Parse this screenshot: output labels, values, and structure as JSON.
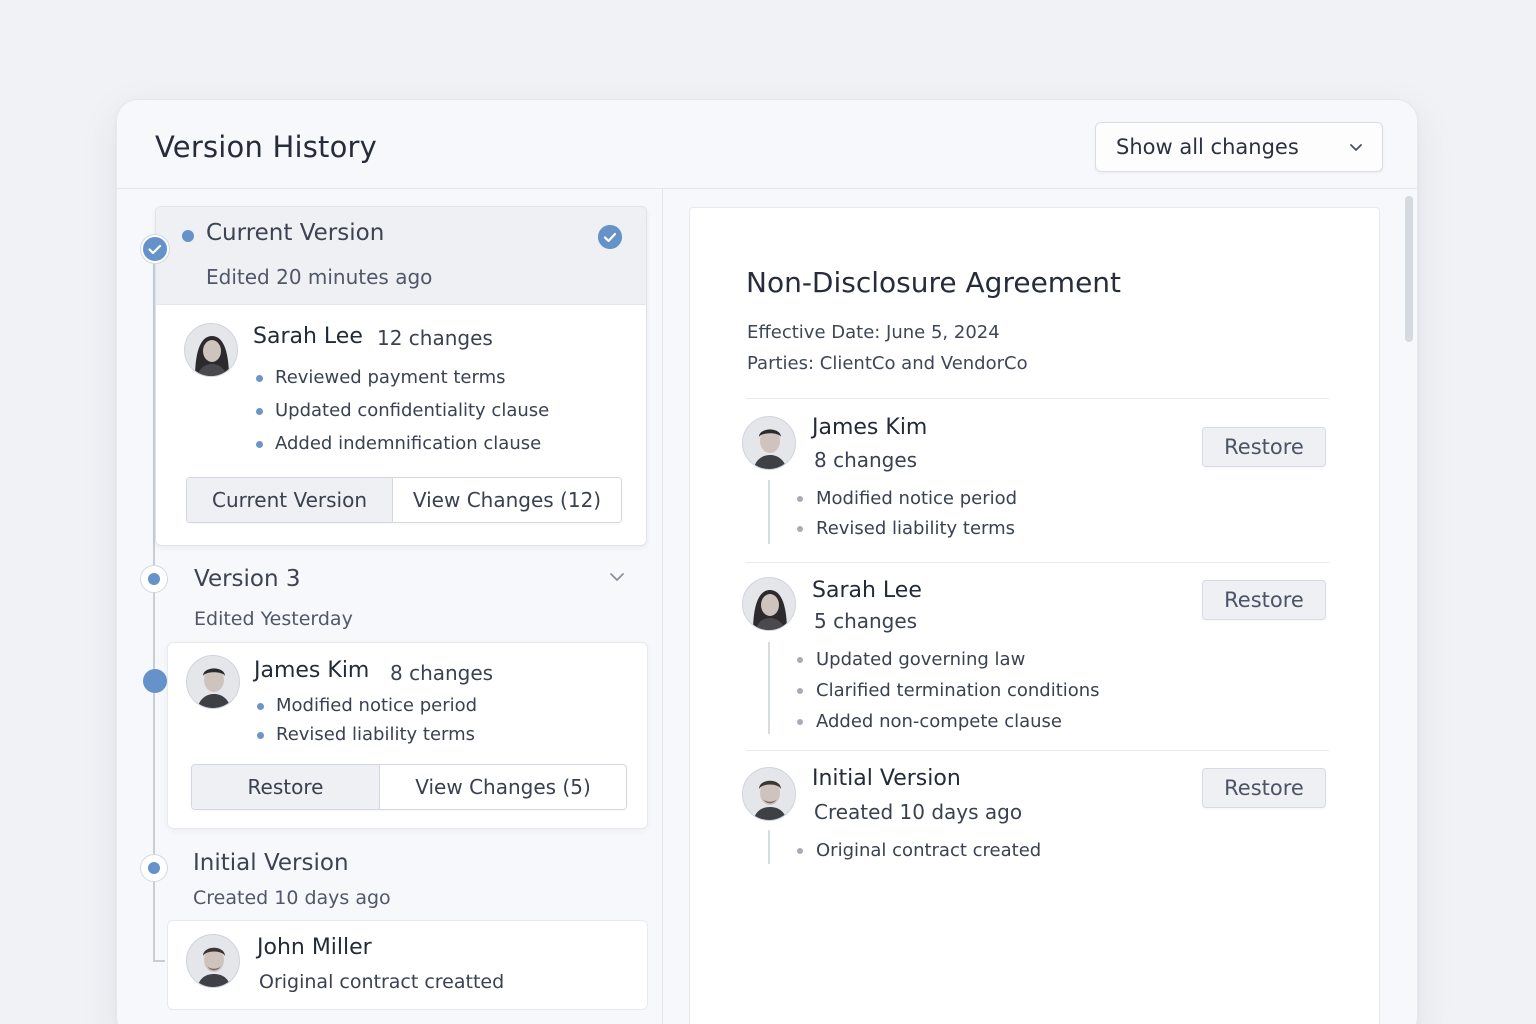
{
  "header": {
    "title": "Version History",
    "filter": "Show all changes"
  },
  "timeline": {
    "current": {
      "title": "Current Version",
      "subtitle": "Edited 20 minutes ago",
      "author": "Sarah Lee",
      "count": "12 changes",
      "changes": [
        "Reviewed payment terms",
        "Updated confidentiality clause",
        "Added indemnification clause"
      ],
      "btn_current": "Current Version",
      "btn_view": "View Changes (12)"
    },
    "v3": {
      "title": "Version 3",
      "subtitle": "Edited Yesterday",
      "author": "James Kim",
      "count": "8 changes",
      "changes": [
        "Modified notice period",
        "Revised liability terms"
      ],
      "btn_restore": "Restore",
      "btn_view": "View Changes (5)"
    },
    "initial": {
      "title": "Initial Version",
      "subtitle": "Created 10 days ago",
      "author": "John Miller",
      "note": "Original contract creatted"
    }
  },
  "document": {
    "title": "Non-Disclosure Agreement",
    "effective": "Effective Date: June 5, 2024",
    "parties": "Parties: ClientCo and VendorCo",
    "entries": [
      {
        "name": "James Kim",
        "meta": "8 changes",
        "changes": [
          "Modified notice period",
          "Revised liability terms"
        ],
        "action": "Restore"
      },
      {
        "name": "Sarah Lee",
        "meta": "5 changes",
        "changes": [
          "Updated governing law",
          "Clarified termination conditions",
          "Added non-compete clause"
        ],
        "action": "Restore"
      },
      {
        "name": "Initial Version",
        "meta": "Created 10 days ago",
        "changes": [
          "Original contract created"
        ],
        "action": "Restore"
      }
    ]
  },
  "colors": {
    "accent": "#6592c9",
    "background": "#f1f2f6",
    "panel": "#ffffff",
    "text": "#2b3140"
  },
  "icons": [
    "chevron-down-icon",
    "check-circle-icon",
    "avatar"
  ]
}
